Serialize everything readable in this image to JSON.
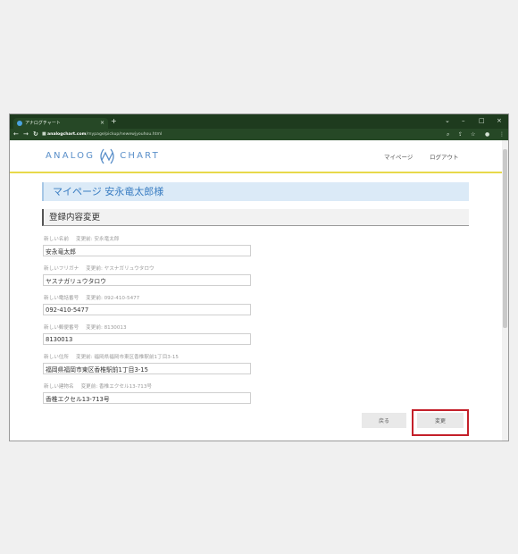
{
  "browser": {
    "tab_title": "アナログチャート",
    "tab_close": "×",
    "new_tab": "+",
    "url_domain": "analogchart.com",
    "url_path": "/mypage/pickup/newewjyouhou.html",
    "window_controls": [
      "⌄",
      "–",
      "□",
      "×"
    ]
  },
  "header": {
    "logo_left": "ANALOG",
    "logo_right": "CHART",
    "links": [
      "マイページ",
      "ログアウト"
    ]
  },
  "page": {
    "title": "マイページ 安永竜太郎様",
    "section_title": "登録内容変更"
  },
  "fields": [
    {
      "label": "新しい名前",
      "previous": "変更前: 安永竜太郎",
      "value": "安永竜太郎"
    },
    {
      "label": "新しいフリガナ",
      "previous": "変更前: ヤスナガリュウタロウ",
      "value": "ヤスナガリュウタロウ"
    },
    {
      "label": "新しい電話番号",
      "previous": "変更前: 092-410-5477",
      "value": "092-410-5477"
    },
    {
      "label": "新しい郵便番号",
      "previous": "変更前: 8130013",
      "value": "8130013"
    },
    {
      "label": "新しい住所",
      "previous": "変更前: 福岡県福岡市東区香椎駅前1丁目3-15",
      "value": "福岡県福岡市東区香椎駅前1丁目3-15"
    },
    {
      "label": "新しい建物名",
      "previous": "変更前: 香椎エクセル13-713号",
      "value": "香椎エクセル13-713号"
    }
  ],
  "buttons": {
    "back": "戻る",
    "change": "変更"
  },
  "colors": {
    "browser_chrome": "#1e3b1e",
    "logo": "#5a8fc9",
    "header_rule": "#e8d94a",
    "title_bg": "#dbeaf7",
    "highlight": "#c4202a"
  }
}
